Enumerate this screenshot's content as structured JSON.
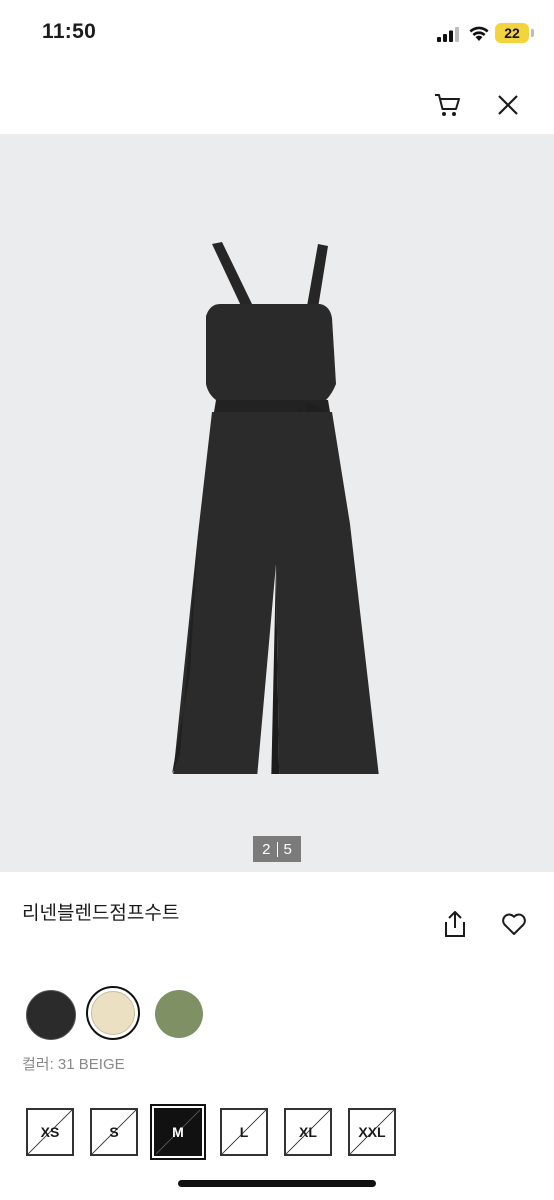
{
  "status_bar": {
    "time": "11:50",
    "battery": "22"
  },
  "gallery": {
    "page_current": "2",
    "page_total": "5"
  },
  "product": {
    "title": "리넨블렌드점프수트"
  },
  "colors": {
    "label": "컬러: 31 BEIGE",
    "options": [
      {
        "name": "black",
        "hex": "#2b2b2b"
      },
      {
        "name": "beige",
        "hex": "#ece0c2",
        "selected": true
      },
      {
        "name": "olive",
        "hex": "#7f9065"
      }
    ]
  },
  "sizes": [
    "XS",
    "S",
    "M",
    "L",
    "XL",
    "XXL"
  ],
  "selected_size": "M",
  "icons": {
    "cart": "cart-icon",
    "close": "close-icon",
    "share": "share-icon",
    "favorite": "heart-icon"
  }
}
